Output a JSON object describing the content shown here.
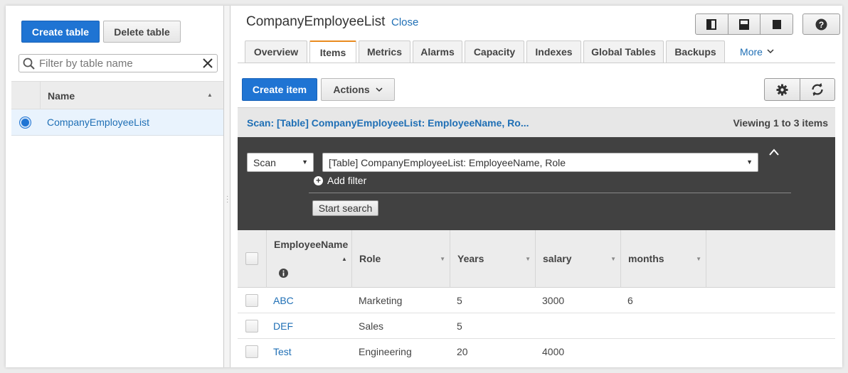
{
  "left": {
    "create_table": "Create table",
    "delete_table": "Delete table",
    "filter_placeholder": "Filter by table name",
    "name_header": "Name",
    "tables": [
      "CompanyEmployeeList"
    ]
  },
  "header": {
    "title": "CompanyEmployeeList",
    "close": "Close"
  },
  "tabs": [
    "Overview",
    "Items",
    "Metrics",
    "Alarms",
    "Capacity",
    "Indexes",
    "Global Tables",
    "Backups"
  ],
  "tabs_more": "More",
  "active_tab": "Items",
  "actions": {
    "create_item": "Create item",
    "actions": "Actions"
  },
  "scan": {
    "title": "Scan: [Table] CompanyEmployeeList: EmployeeName, Ro...",
    "viewing": "Viewing 1 to 3 items",
    "mode": "Scan",
    "target": "[Table] CompanyEmployeeList: EmployeeName, Role",
    "add_filter": "Add filter",
    "start_search": "Start search"
  },
  "columns": [
    "EmployeeName",
    "Role",
    "Years",
    "salary",
    "months"
  ],
  "rows": [
    {
      "EmployeeName": "ABC",
      "Role": "Marketing",
      "Years": "5",
      "salary": "3000",
      "months": "6"
    },
    {
      "EmployeeName": "DEF",
      "Role": "Sales",
      "Years": "5",
      "salary": "",
      "months": ""
    },
    {
      "EmployeeName": "Test",
      "Role": "Engineering",
      "Years": "20",
      "salary": "4000",
      "months": ""
    }
  ],
  "colors": {
    "primary": "#1f74d3",
    "link": "#1f6fb5",
    "tab_accent": "#e98b1f",
    "dark_panel": "#414141"
  },
  "icons": [
    "search-icon",
    "clear-icon",
    "sort-asc-icon",
    "layout-split-icon",
    "layout-bottom-icon",
    "layout-full-icon",
    "help-icon",
    "chevron-down-icon",
    "settings-icon",
    "refresh-icon",
    "add-circle-icon",
    "collapse-icon",
    "info-icon"
  ]
}
